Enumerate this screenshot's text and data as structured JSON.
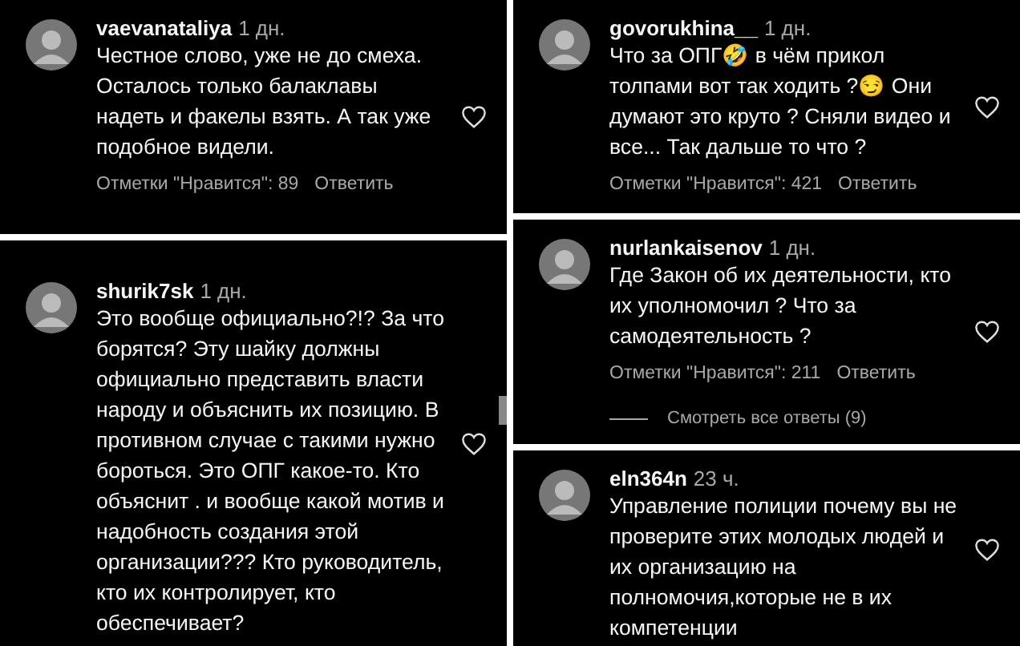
{
  "columns": [
    {
      "panels": [
        {
          "username": "vaevanataliya",
          "time": "1 дн.",
          "text": "Честное слово, уже не до смеха. Осталось только балаклавы надеть и факелы взять. А так уже подобное видели.",
          "likes": "Отметки \"Нравится\": 89",
          "reply": "Ответить"
        },
        {
          "username": "shurik7sk",
          "time": "1 дн.",
          "text": "Это вообще официально?!? За что борятся? Эту шайку должны официально представить власти народу и объяснить их позицию. В противном случае с такими нужно бороться. Это ОПГ какое-то. Кто объяснит . и вообще какой мотив и надобность создания этой организации??? Кто руководитель, кто их контролирует, кто обеспечивает?"
        }
      ]
    },
    {
      "panels": [
        {
          "username": "govorukhina__",
          "time": "1 дн.",
          "text": "Что за ОПГ🤣 в чём прикол толпами вот так ходить ?😏 Они думают это круто ? Сняли видео и все... Так дальше то что ?",
          "likes": "Отметки \"Нравится\": 421",
          "reply": "Ответить"
        },
        {
          "username": "nurlankaisenov",
          "time": "1 дн.",
          "text": "Где Закон об их деятельности, кто их уполномочил ? Что за самодеятельность ?",
          "likes": "Отметки \"Нравится\": 211",
          "reply": "Ответить",
          "view_replies": "Смотреть все ответы (9)"
        },
        {
          "username": "eln364n",
          "time": "23 ч.",
          "text": "Управление полиции почему вы не проверите этих молодых людей и их организацию на полномочия,которые не в их компетенции"
        }
      ]
    }
  ]
}
